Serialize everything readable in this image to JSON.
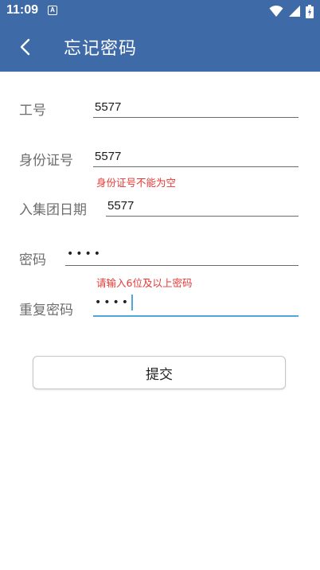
{
  "status": {
    "time": "11:09",
    "app_icon_letter": "A"
  },
  "header": {
    "title": "忘记密码"
  },
  "form": {
    "employee_id": {
      "label": "工号",
      "value": "5577"
    },
    "id_card": {
      "label": "身份证号",
      "value": "5577",
      "error": "身份证号不能为空"
    },
    "join_date": {
      "label": "入集团日期",
      "value": "5577"
    },
    "password": {
      "label": "密码",
      "masked": "••••",
      "error": "请输入6位及以上密码"
    },
    "confirm_password": {
      "label": "重复密码",
      "masked": "••••"
    },
    "submit_label": "提交"
  },
  "colors": {
    "header": "#3f6aa8",
    "error": "#e53935",
    "focus": "#4fa6d8"
  }
}
